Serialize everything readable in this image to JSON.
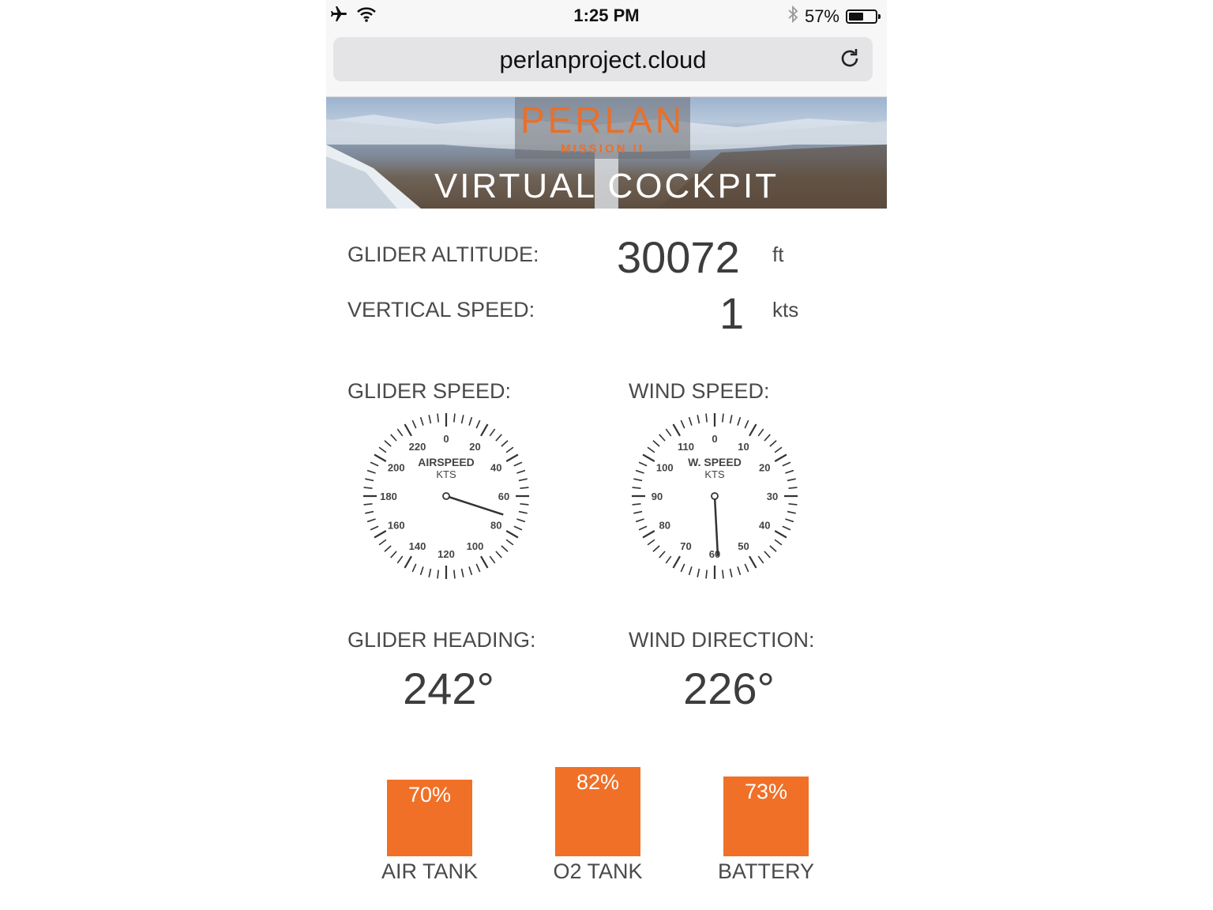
{
  "status_bar": {
    "time": "1:25 PM",
    "battery_text": "57%",
    "battery_level": 0.57,
    "icons": [
      "airplane-icon",
      "wifi-icon",
      "bluetooth-icon",
      "battery-icon"
    ]
  },
  "browser": {
    "url": "perlanproject.cloud",
    "reload_icon": "reload-icon"
  },
  "banner": {
    "logo_title": "PERLAN",
    "logo_subtitle": "MISSION II",
    "title": "VIRTUAL COCKPIT"
  },
  "altitude": {
    "label": "GLIDER ALTITUDE:",
    "value": "30072",
    "unit": "ft"
  },
  "vertical_speed": {
    "label": "VERTICAL SPEED:",
    "value": "1",
    "unit": "kts"
  },
  "glider_speed": {
    "label": "GLIDER SPEED:",
    "gauge_title": "AIRSPEED",
    "gauge_unit": "KTS",
    "ticks": [
      "0",
      "20",
      "40",
      "60",
      "80",
      "100",
      "120",
      "140",
      "160",
      "180",
      "200",
      "220"
    ],
    "max": 240,
    "value": 72
  },
  "wind_speed": {
    "label": "WIND SPEED:",
    "gauge_title": "W. SPEED",
    "gauge_unit": "KTS",
    "ticks": [
      "0",
      "10",
      "20",
      "30",
      "40",
      "50",
      "60",
      "70",
      "80",
      "90",
      "100",
      "110"
    ],
    "max": 120,
    "value": 59
  },
  "glider_heading": {
    "label": "GLIDER HEADING:",
    "value": "242°"
  },
  "wind_direction": {
    "label": "WIND DIRECTION:",
    "value": "226°"
  },
  "levels": [
    {
      "label": "AIR TANK",
      "text": "70%",
      "fraction": 0.7
    },
    {
      "label": "O2 TANK",
      "text": "82%",
      "fraction": 0.82
    },
    {
      "label": "BATTERY",
      "text": "73%",
      "fraction": 0.73
    }
  ],
  "colors": {
    "accent": "#f07028",
    "text": "#4a4a4a"
  }
}
